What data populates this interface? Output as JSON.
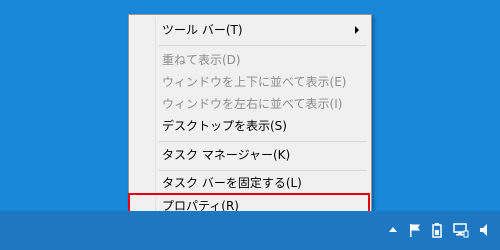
{
  "desktop": {
    "background_color": "#1a86d8"
  },
  "context_menu": {
    "items": [
      {
        "label": "ツール バー(T)",
        "enabled": true,
        "has_submenu": true
      },
      {
        "label": "重ねて表示(D)",
        "enabled": false
      },
      {
        "label": "ウィンドウを上下に並べて表示(E)",
        "enabled": false
      },
      {
        "label": "ウィンドウを左右に並べて表示(I)",
        "enabled": false
      },
      {
        "label": "デスクトップを表示(S)",
        "enabled": true
      },
      {
        "label": "タスク マネージャー(K)",
        "enabled": true
      },
      {
        "label": "タスク バーを固定する(L)",
        "enabled": true
      },
      {
        "label": "プロパティ(R)",
        "enabled": true,
        "highlighted": true
      }
    ]
  },
  "annotation": {
    "highlight_color": "#e50012"
  },
  "taskbar": {
    "color": "#1d78c1",
    "tray_icons": [
      "chevron-up-icon",
      "flag-icon",
      "battery-icon",
      "network-icon",
      "volume-icon"
    ]
  }
}
